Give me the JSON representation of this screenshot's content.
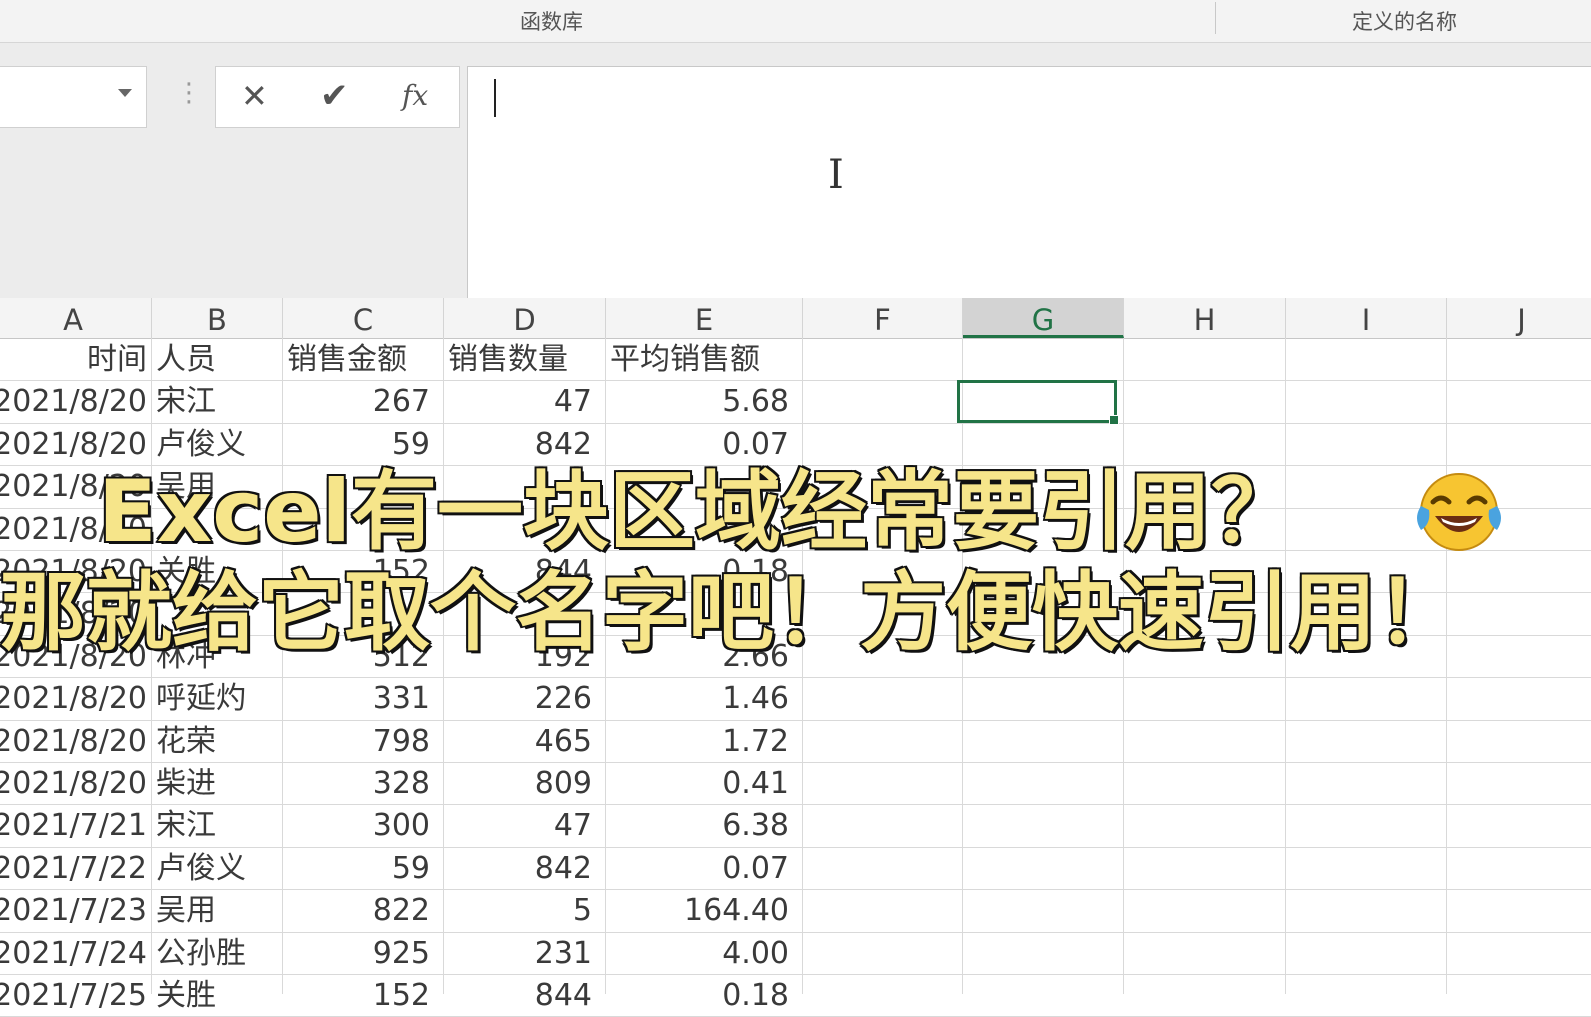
{
  "ribbon": {
    "group_function_library": "函数库",
    "group_defined_names": "定义的名称"
  },
  "formula_bar": {
    "name_box_value": "",
    "cancel_icon": "✕",
    "enter_icon": "✔",
    "insert_function_icon": "fx",
    "formula_value": ""
  },
  "sheet": {
    "columns": [
      "A",
      "B",
      "C",
      "D",
      "E",
      "F",
      "G",
      "H",
      "I",
      "J"
    ],
    "selected_column": "G",
    "header_row": [
      "时间",
      "人员",
      "销售金额",
      "销售数量",
      "平均销售额"
    ],
    "rows": [
      [
        "2021/8/20",
        "宋江",
        "267",
        "47",
        "5.68"
      ],
      [
        "2021/8/20",
        "卢俊义",
        "59",
        "842",
        "0.07"
      ],
      [
        "2021/8/20",
        "吴用",
        "",
        "",
        ""
      ],
      [
        "2021/8/20",
        "",
        "",
        "",
        ""
      ],
      [
        "2021/8/20",
        "关胜",
        "152",
        "844",
        "0.18"
      ],
      [
        "2021/8/20",
        "",
        "",
        "",
        ""
      ],
      [
        "2021/8/20",
        "林冲",
        "512",
        "192",
        "2.66"
      ],
      [
        "2021/8/20",
        "呼延灼",
        "331",
        "226",
        "1.46"
      ],
      [
        "2021/8/20",
        "花荣",
        "798",
        "465",
        "1.72"
      ],
      [
        "2021/8/20",
        "柴进",
        "328",
        "809",
        "0.41"
      ],
      [
        "2021/7/21",
        "宋江",
        "300",
        "47",
        "6.38"
      ],
      [
        "2021/7/22",
        "卢俊义",
        "59",
        "842",
        "0.07"
      ],
      [
        "2021/7/23",
        "吴用",
        "822",
        "5",
        "164.40"
      ],
      [
        "2021/7/24",
        "公孙胜",
        "925",
        "231",
        "4.00"
      ],
      [
        "2021/7/25",
        "关胜",
        "152",
        "844",
        "0.18"
      ]
    ]
  },
  "caption": {
    "line1": "Excel有一块区域经常要引用？",
    "line2": "那就给它取个名字吧！方便快速引用！",
    "emoji_name": "face-with-tears-of-joy"
  },
  "colors": {
    "accent_green": "#217346",
    "caption_fill": "#f6e58a",
    "caption_stroke": "#111111"
  }
}
